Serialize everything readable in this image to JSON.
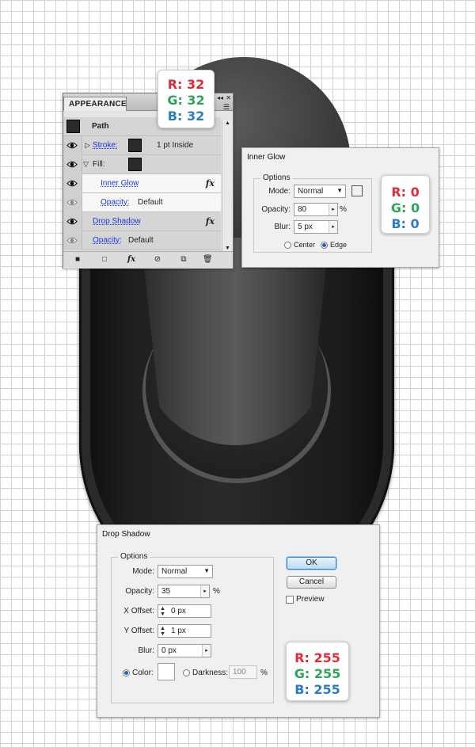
{
  "appearance": {
    "tab": "APPEARANCE",
    "object": "Path",
    "stroke_label": "Stroke:",
    "stroke_value": "1 pt  Inside",
    "fill_label": "Fill:",
    "inner_glow": "Inner Glow",
    "opacity_label": "Opacity:",
    "opacity_default": "Default",
    "drop_shadow": "Drop Shadow",
    "fx": "fx"
  },
  "card_fill": {
    "r": "R: 32",
    "g": "G: 32",
    "b": "B: 32"
  },
  "inner_glow": {
    "title": "Inner Glow",
    "options": "Options",
    "mode_label": "Mode:",
    "mode": "Normal",
    "opacity_label": "Opacity:",
    "opacity": "80",
    "opacity_unit": "%",
    "blur_label": "Blur:",
    "blur": "5 px",
    "center": "Center",
    "edge": "Edge",
    "color": "#000000"
  },
  "card_glow": {
    "r": "R: 0",
    "g": "G: 0",
    "b": "B: 0"
  },
  "drop_shadow": {
    "title": "Drop Shadow",
    "options": "Options",
    "mode_label": "Mode:",
    "mode": "Normal",
    "opacity_label": "Opacity:",
    "opacity": "35",
    "opacity_unit": "%",
    "xoffset_label": "X Offset:",
    "xoffset": "0 px",
    "yoffset_label": "Y Offset:",
    "yoffset": "1 px",
    "blur_label": "Blur:",
    "blur": "0 px",
    "color_label": "Color:",
    "darkness_label": "Darkness:",
    "darkness": "100",
    "darkness_unit": "%",
    "ok": "OK",
    "cancel": "Cancel",
    "preview": "Preview",
    "color": "#ffffff"
  },
  "card_shadow": {
    "r": "R: 255",
    "g": "G: 255",
    "b": "B: 255"
  }
}
